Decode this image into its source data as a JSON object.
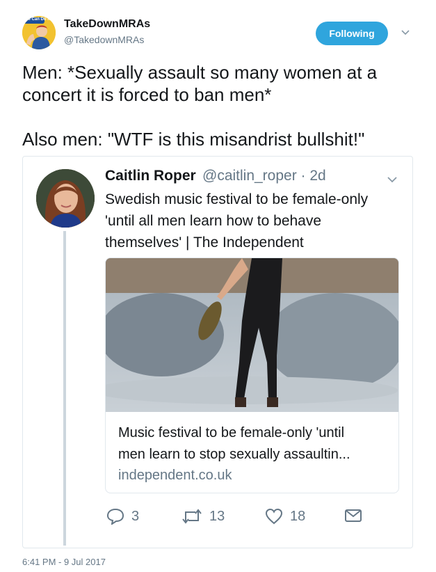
{
  "tweet": {
    "author_name": "TakeDownMRAs",
    "author_handle": "@TakedownMRAs",
    "follow_button": "Following",
    "text": "Men: *Sexually assault so many women at a\nconcert it is forced to ban men*\n\nAlso men: \"WTF is this misandrist bullshit!\"",
    "timestamp": "6:41 PM - 9 Jul 2017",
    "avatar_badge": "We Can Do It!"
  },
  "quoted": {
    "author_name": "Caitlin Roper",
    "author_handle": "@caitlin_roper · 2d",
    "text": "Swedish music festival to be female-only\n'until all men learn how to behave\nthemselves' | The Independent",
    "link_card": {
      "title": "Music festival to be female-only 'until\nmen learn to stop sexually assaultin...",
      "domain": "independent.co.uk"
    },
    "actions": {
      "reply_count": "3",
      "retweet_count": "13",
      "like_count": "18"
    }
  },
  "icons": {
    "reply": "reply-icon",
    "retweet": "retweet-icon",
    "like": "heart-icon",
    "dm": "envelope-icon",
    "more": "chevron-down-icon"
  },
  "colors": {
    "follow_button": "#2fa5dd",
    "muted_text": "#657786",
    "border": "#e1e8ed"
  }
}
